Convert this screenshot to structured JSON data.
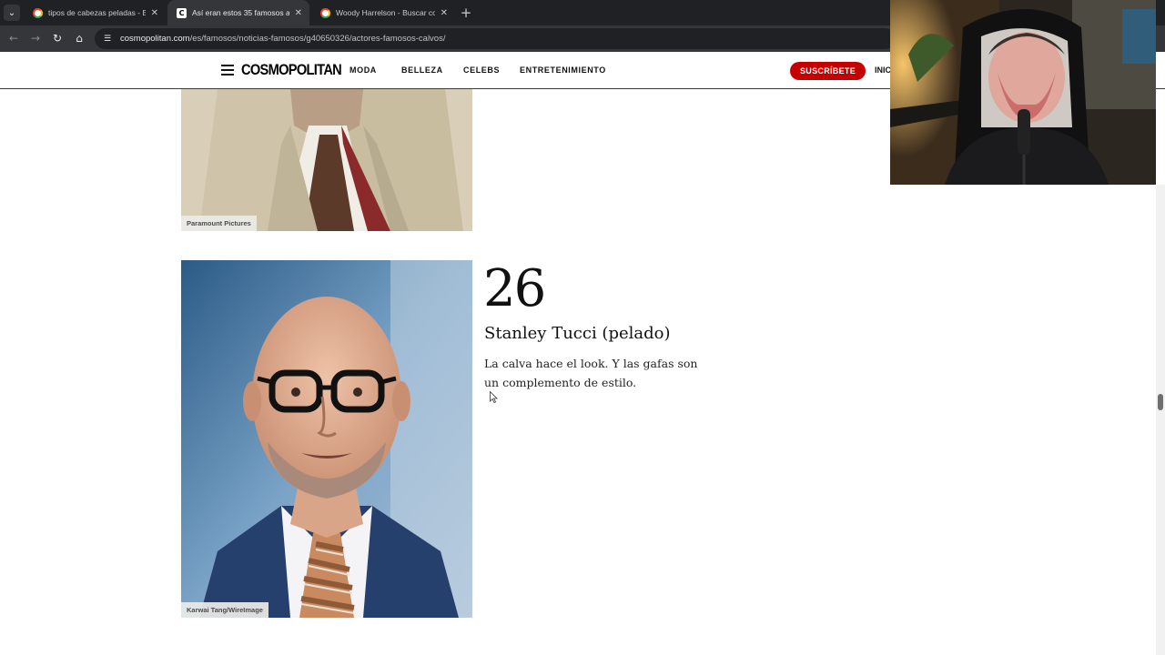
{
  "browser": {
    "tabs": [
      {
        "title": "tipos de cabezas peladas - Busc",
        "favicon": "google-icon",
        "active": false
      },
      {
        "title": "Así eran estos 35 famosos actor",
        "favicon": "cosmopolitan-icon",
        "active": true
      },
      {
        "title": "Woody Harrelson - Buscar con",
        "favicon": "google-icon",
        "active": false
      }
    ],
    "new_tab_label": "+",
    "url_host": "cosmopolitan.com",
    "url_path": "/es/famosos/noticias-famosos/g40650326/actores-famosos-calvos/"
  },
  "site": {
    "logo": "COSMOPOLITAN",
    "nav": [
      "MODA",
      "BELLEZA",
      "CELEBS",
      "ENTRETENIMIENTO"
    ],
    "subscribe_label": "SUSCRÍBETE",
    "login_label": "INIC"
  },
  "article": {
    "previous_image_credit": "Paramount Pictures",
    "item": {
      "number": "26",
      "title": "Stanley Tucci (pelado)",
      "description": "La calva hace el look. Y las gafas son un complemento de estilo.",
      "image_credit": "Karwai Tang/WireImage"
    }
  },
  "scroll": {
    "position_fraction": 0.46
  },
  "colors": {
    "brand_red": "#c60000",
    "tab_bar": "#202124",
    "toolbar": "#35363a"
  }
}
